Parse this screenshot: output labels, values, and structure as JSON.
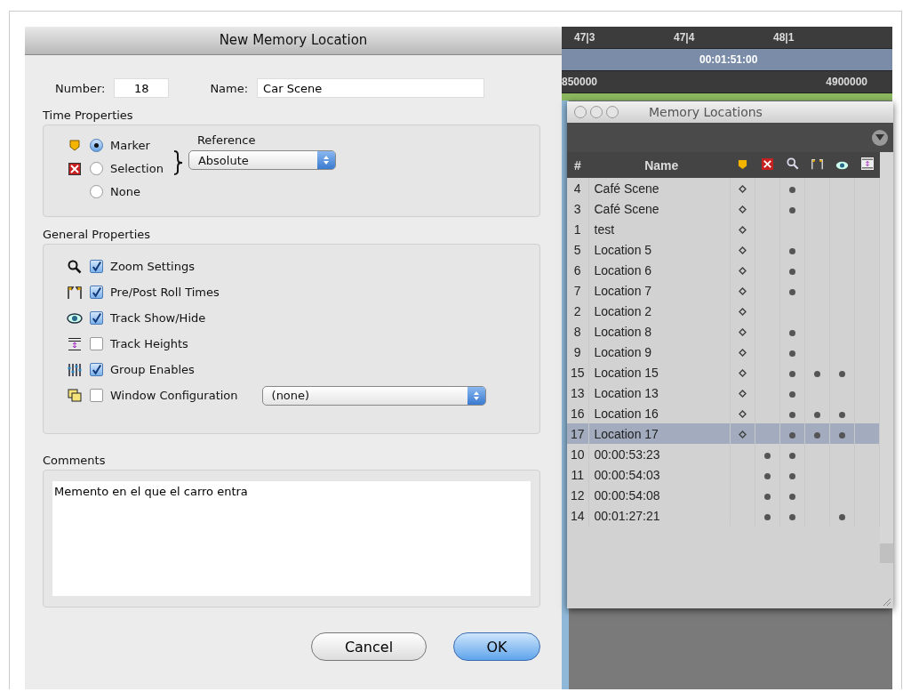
{
  "dialog": {
    "title": "New Memory Location",
    "number": {
      "label": "Number:",
      "value": "18"
    },
    "name": {
      "label": "Name:",
      "value": "Car Scene"
    },
    "time_properties": {
      "title": "Time Properties",
      "options": [
        {
          "kind": "marker",
          "label": "Marker",
          "selected": true
        },
        {
          "kind": "selection",
          "label": "Selection",
          "selected": false
        },
        {
          "kind": "none",
          "label": "None",
          "selected": false
        }
      ],
      "reference": {
        "label": "Reference",
        "value": "Absolute"
      }
    },
    "general_properties": {
      "title": "General Properties",
      "items": [
        {
          "kind": "zoom",
          "label": "Zoom Settings",
          "checked": true
        },
        {
          "kind": "preroll",
          "label": "Pre/Post Roll Times",
          "checked": true
        },
        {
          "kind": "showhide",
          "label": "Track Show/Hide",
          "checked": true
        },
        {
          "kind": "heights",
          "label": "Track Heights",
          "checked": false
        },
        {
          "kind": "group",
          "label": "Group Enables",
          "checked": true
        },
        {
          "kind": "window",
          "label": "Window Configuration",
          "checked": false
        }
      ],
      "window_configuration": "(none)"
    },
    "comments": {
      "title": "Comments",
      "value": "Memento en el que el carro entra"
    },
    "buttons": [
      {
        "label": "Cancel",
        "default": false
      },
      {
        "label": "OK",
        "default": true
      }
    ]
  },
  "timeline": {
    "bars": [
      "47|3",
      "47|4",
      "48|1"
    ],
    "timecode": "00:01:51:00",
    "samples": [
      "850000",
      "4900000"
    ]
  },
  "memory_locations": {
    "title": "Memory Locations",
    "columns": [
      "#",
      "Name"
    ],
    "rows": [
      {
        "num": "4",
        "name": "Café Scene",
        "marker": true,
        "selection": false,
        "zoom": true,
        "preroll": false,
        "showhide": false,
        "selected": false
      },
      {
        "num": "3",
        "name": "Café Scene",
        "marker": true,
        "selection": false,
        "zoom": true,
        "preroll": false,
        "showhide": false,
        "selected": false
      },
      {
        "num": "1",
        "name": "test",
        "marker": true,
        "selection": false,
        "zoom": false,
        "preroll": false,
        "showhide": false,
        "selected": false
      },
      {
        "num": "5",
        "name": "Location 5",
        "marker": true,
        "selection": false,
        "zoom": true,
        "preroll": false,
        "showhide": false,
        "selected": false
      },
      {
        "num": "6",
        "name": "Location 6",
        "marker": true,
        "selection": false,
        "zoom": true,
        "preroll": false,
        "showhide": false,
        "selected": false
      },
      {
        "num": "7",
        "name": "Location 7",
        "marker": true,
        "selection": false,
        "zoom": true,
        "preroll": false,
        "showhide": false,
        "selected": false
      },
      {
        "num": "2",
        "name": "Location 2",
        "marker": true,
        "selection": false,
        "zoom": false,
        "preroll": false,
        "showhide": false,
        "selected": false
      },
      {
        "num": "8",
        "name": "Location 8",
        "marker": true,
        "selection": false,
        "zoom": true,
        "preroll": false,
        "showhide": false,
        "selected": false
      },
      {
        "num": "9",
        "name": "Location 9",
        "marker": true,
        "selection": false,
        "zoom": true,
        "preroll": false,
        "showhide": false,
        "selected": false
      },
      {
        "num": "15",
        "name": "Location 15",
        "marker": true,
        "selection": false,
        "zoom": true,
        "preroll": true,
        "showhide": true,
        "selected": false
      },
      {
        "num": "13",
        "name": "Location 13",
        "marker": true,
        "selection": false,
        "zoom": true,
        "preroll": false,
        "showhide": false,
        "selected": false
      },
      {
        "num": "16",
        "name": "Location 16",
        "marker": true,
        "selection": false,
        "zoom": true,
        "preroll": true,
        "showhide": true,
        "selected": false
      },
      {
        "num": "17",
        "name": "Location 17",
        "marker": true,
        "selection": false,
        "zoom": true,
        "preroll": true,
        "showhide": true,
        "selected": true
      },
      {
        "num": "10",
        "name": "00:00:53:23",
        "marker": false,
        "selection": true,
        "zoom": true,
        "preroll": false,
        "showhide": false,
        "selected": false
      },
      {
        "num": "11",
        "name": "00:00:54:03",
        "marker": false,
        "selection": true,
        "zoom": true,
        "preroll": false,
        "showhide": false,
        "selected": false
      },
      {
        "num": "12",
        "name": "00:00:54:08",
        "marker": false,
        "selection": true,
        "zoom": true,
        "preroll": false,
        "showhide": false,
        "selected": false
      },
      {
        "num": "14",
        "name": "00:01:27:21",
        "marker": false,
        "selection": true,
        "zoom": true,
        "preroll": false,
        "showhide": true,
        "selected": false
      }
    ]
  }
}
